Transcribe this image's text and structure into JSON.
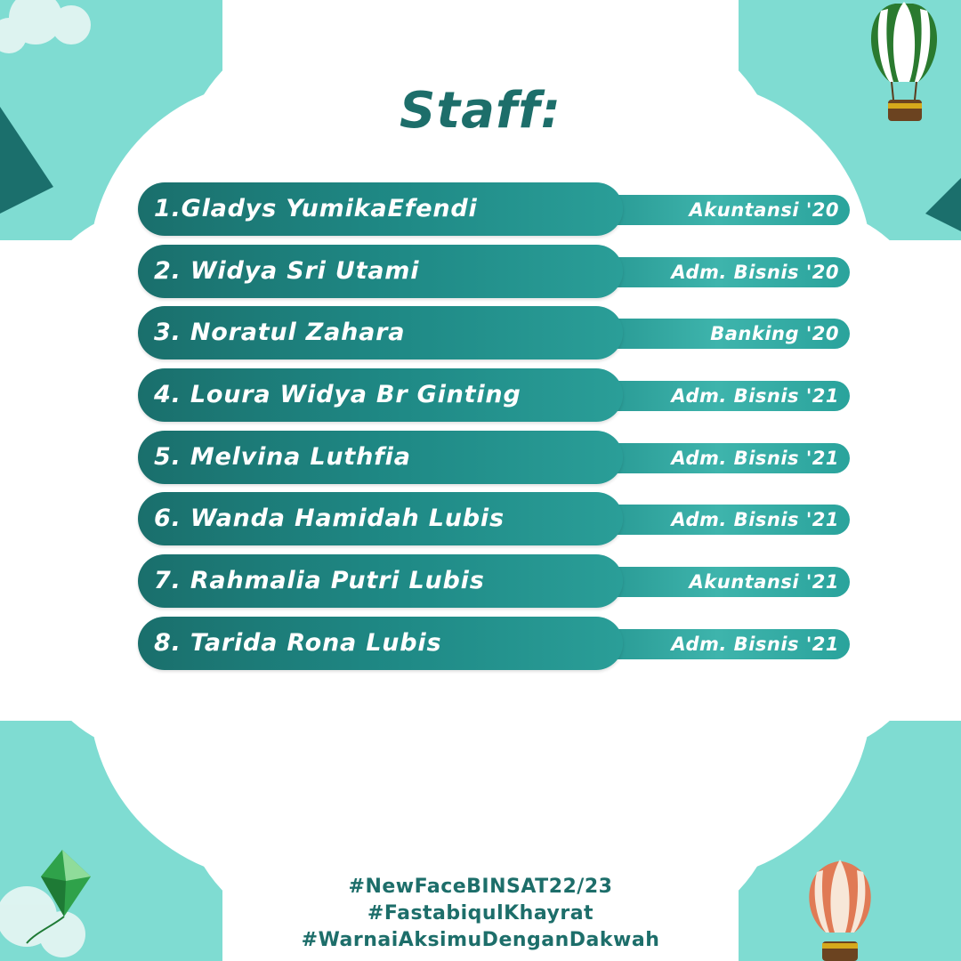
{
  "title": "Staff:",
  "staff": [
    {
      "name": "1.Gladys YumikaEfendi",
      "dept": "Akuntansi '20"
    },
    {
      "name": "2. Widya Sri Utami",
      "dept": "Adm. Bisnis '20"
    },
    {
      "name": "3. Noratul Zahara",
      "dept": "Banking '20"
    },
    {
      "name": "4. Loura Widya Br Ginting",
      "dept": "Adm. Bisnis '21"
    },
    {
      "name": "5. Melvina Luthfia",
      "dept": "Adm. Bisnis '21"
    },
    {
      "name": "6. Wanda Hamidah Lubis",
      "dept": "Adm. Bisnis '21"
    },
    {
      "name": "7. Rahmalia Putri Lubis",
      "dept": "Akuntansi '21"
    },
    {
      "name": "8. Tarida Rona Lubis",
      "dept": "Adm. Bisnis '21"
    }
  ],
  "hashtags": [
    "#NewFaceBINSAT22/23",
    "#FastabiqulKhayrat",
    "#WarnaiAksimuDenganDakwah"
  ],
  "colors": {
    "background": "#7fdcd2",
    "card": "#ffffff",
    "primary": "#1d6e6a",
    "pill_dark": "#1a6f6c",
    "tag": "#3eb4ac"
  },
  "decorations": [
    "hot-air-balloon-green-icon",
    "hot-air-balloon-orange-icon",
    "kite-icon",
    "cloud-icon"
  ]
}
